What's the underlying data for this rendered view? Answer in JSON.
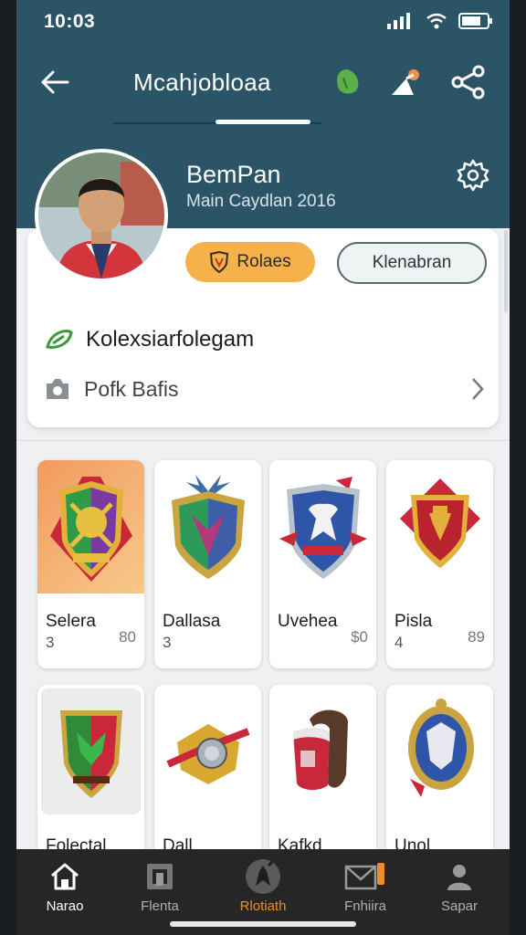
{
  "status": {
    "time": "10:03"
  },
  "header": {
    "title": "Mcahjobloaa"
  },
  "profile": {
    "name": "BemPan",
    "subtitle": "Main Caydlan 2016",
    "primary_button": "Rolaes",
    "secondary_button": "Klenabran",
    "row1_label": "Kolexsiarfolegam",
    "row2_label": "Pofk Bafis"
  },
  "items": [
    {
      "name": "Selera",
      "count": "3",
      "price": "80",
      "icon": "green-purple-shield-icon"
    },
    {
      "name": "Dallasa",
      "count": "3",
      "price": "",
      "icon": "green-blue-shield-icon"
    },
    {
      "name": "Uvehea",
      "count": "",
      "price": "$0",
      "icon": "eagle-shield-icon"
    },
    {
      "name": "Pisla",
      "count": "4",
      "price": "89",
      "icon": "red-gold-crest-icon"
    },
    {
      "name": "Folectal",
      "count": "",
      "price": "",
      "icon": "dragon-shield-icon"
    },
    {
      "name": "Dall",
      "count": "",
      "price": "",
      "icon": "gold-medallion-icon"
    },
    {
      "name": "Kafkd",
      "count": "",
      "price": "",
      "icon": "red-bracer-icon"
    },
    {
      "name": "Unol",
      "count": "",
      "price": "",
      "icon": "blue-oval-crest-icon"
    }
  ],
  "bottom_nav": [
    {
      "label": "Narao",
      "icon": "home-icon"
    },
    {
      "label": "Flenta",
      "icon": "collection-icon"
    },
    {
      "label": "Rlotiath",
      "icon": "warrior-icon"
    },
    {
      "label": "Fnhiira",
      "icon": "mail-icon"
    },
    {
      "label": "Sapar",
      "icon": "profile-icon"
    }
  ],
  "colors": {
    "header": "#2b5566",
    "accent": "#f6b14a",
    "active_tab": "#f28c28"
  }
}
